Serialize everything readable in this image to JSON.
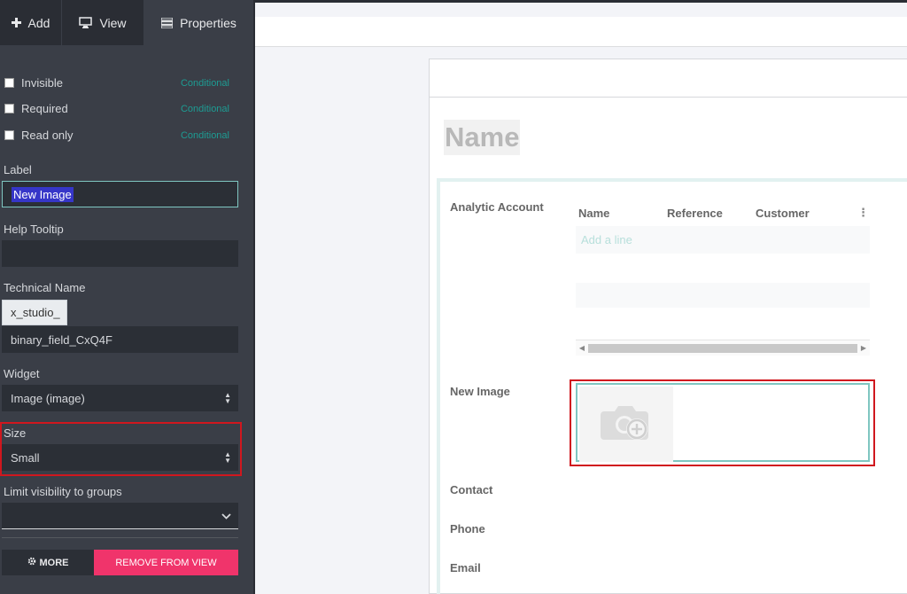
{
  "tabs": {
    "add": "Add",
    "view": "View",
    "properties": "Properties"
  },
  "properties": {
    "invisible": {
      "label": "Invisible",
      "conditional": "Conditional",
      "checked": false
    },
    "required": {
      "label": "Required",
      "conditional": "Conditional",
      "checked": false
    },
    "read_only": {
      "label": "Read only",
      "conditional": "Conditional",
      "checked": false
    },
    "label_title": "Label",
    "label_value": "New Image",
    "help_tooltip_title": "Help Tooltip",
    "help_tooltip_value": "",
    "technical_name_title": "Technical Name",
    "technical_name_prefix": "x_studio_",
    "technical_name_value": "binary_field_CxQ4F",
    "widget_title": "Widget",
    "widget_value": "Image (image)",
    "size_title": "Size",
    "size_value": "Small",
    "groups_title": "Limit visibility to groups",
    "groups_value": "",
    "more_button": "MORE",
    "remove_button": "REMOVE FROM VIEW"
  },
  "form": {
    "name_placeholder": "Name",
    "analytic_account_label": "Analytic Account",
    "table_headers": [
      "Name",
      "Reference",
      "Customer"
    ],
    "add_line": "Add a line",
    "new_image_label": "New Image",
    "contact_label": "Contact",
    "phone_label": "Phone",
    "email_label": "Email"
  },
  "colors": {
    "sidebar_bg": "#3a3e47",
    "accent_teal": "#1d9c93",
    "remove_pink": "#f0346b",
    "highlight_red": "#d0171e"
  },
  "icons": {
    "add": "plus-icon",
    "view": "monitor-icon",
    "properties": "properties-icon",
    "more": "gear-icon",
    "image_placeholder": "camera-add-icon"
  }
}
